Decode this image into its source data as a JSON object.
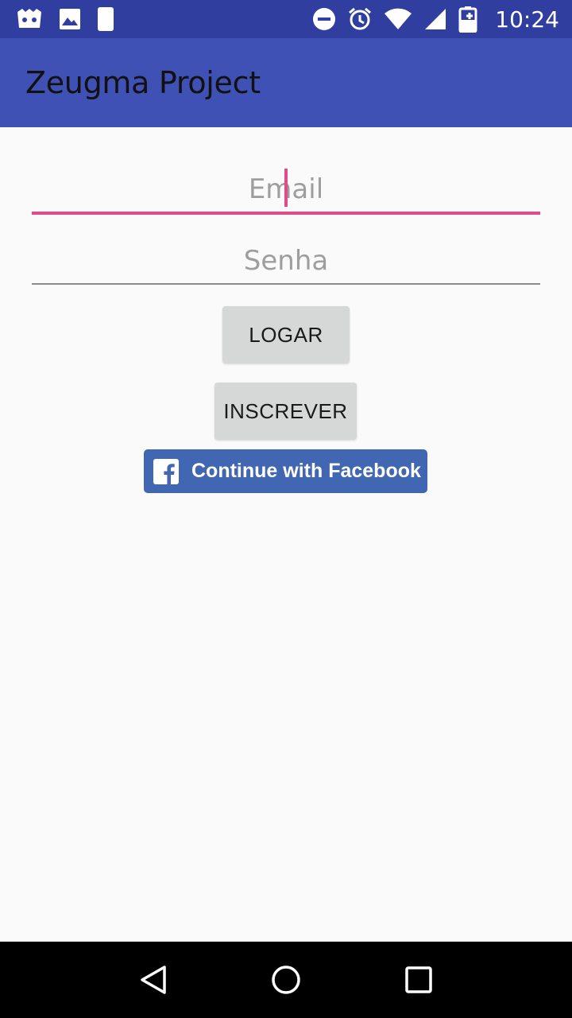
{
  "status_bar": {
    "time": "10:24",
    "left_icons": [
      "android-notification-icon",
      "image-icon",
      "phone-moon-icon"
    ],
    "right_icons": [
      "do-not-disturb-icon",
      "alarm-icon",
      "wifi-icon",
      "signal-icon",
      "battery-charging-icon"
    ]
  },
  "app_bar": {
    "title": "Zeugma Project"
  },
  "form": {
    "email_placeholder": "Email",
    "email_value": "",
    "password_placeholder": "Senha",
    "password_value": ""
  },
  "buttons": {
    "login_label": "LOGAR",
    "signup_label": "INSCREVER",
    "facebook_label": "Continue with Facebook"
  },
  "colors": {
    "status_bar": "#303f9f",
    "app_bar": "#3f51b5",
    "accent": "#e04b8a",
    "facebook": "#4267b2",
    "button_gray": "#d6d7d7"
  },
  "nav_bar": {
    "buttons": [
      "back-icon",
      "home-icon",
      "recents-icon"
    ]
  }
}
